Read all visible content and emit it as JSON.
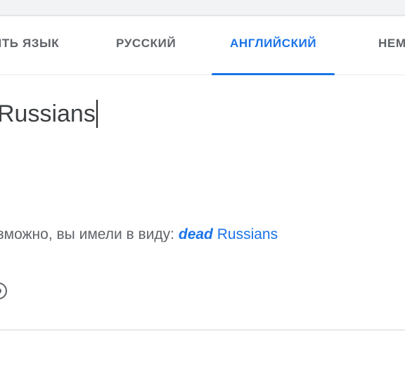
{
  "language_tabs": [
    {
      "label": "ИТЬ ЯЗЫК",
      "active": false
    },
    {
      "label": "РУССКИЙ",
      "active": false
    },
    {
      "label": "АНГЛИЙСКИЙ",
      "active": true
    },
    {
      "label": "НЕМ",
      "active": false
    }
  ],
  "source": {
    "text": "Russians"
  },
  "suggestion": {
    "prefix": "зможно, вы имели в виду:",
    "corrected_word": "dead",
    "rest": "Russians"
  },
  "colors": {
    "accent": "#1a73e8",
    "text_secondary": "#5f6368"
  },
  "icons": {
    "clear": "clear-circle-icon"
  }
}
